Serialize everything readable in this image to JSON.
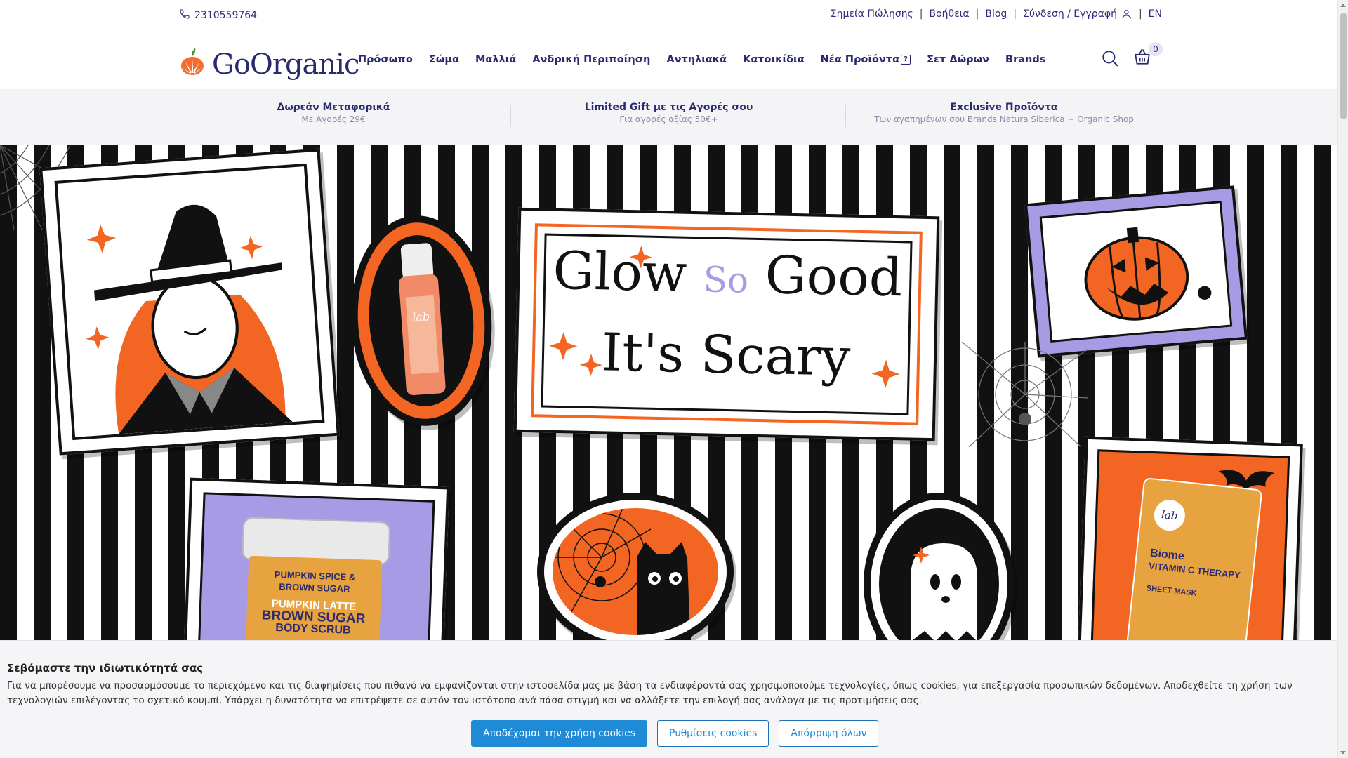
{
  "topbar": {
    "phone": "2310559764",
    "links": [
      "Σημεία Πώλησης",
      "Βοήθεια",
      "Blog",
      "Σύνδεση / Εγγραφή"
    ],
    "lang": "EN"
  },
  "header": {
    "logo": "GoOrganic",
    "nav": [
      "Πρόσωπο",
      "Σώμα",
      "Μαλλιά",
      "Ανδρική Περιποίηση",
      "Αντηλιακά",
      "Κατοικίδια",
      "Νέα Προϊόντα",
      "Σετ Δώρων",
      "Brands"
    ],
    "new_badge": "?",
    "cart_count": "0"
  },
  "usp": [
    {
      "title": "Δωρεάν Μεταφορικά",
      "sub": "Με Αγορές 29€"
    },
    {
      "title": "Limited Gift με τις Αγορές σου",
      "sub": "Για αγορές αξίας 50€+"
    },
    {
      "title": "Exclusive Προϊόντα",
      "sub": "Των αγαπημένων σου Brands Natura Siberica + Organic Shop"
    }
  ],
  "hero": {
    "headline_1": "Glow",
    "headline_so": "So",
    "headline_2": "Good",
    "headline_3": "It's Scary",
    "jar_line_1": "PUMPKIN SPICE &",
    "jar_line_2": "BROWN SUGAR",
    "jar_line_3": "PUMPKIN LATTE",
    "jar_line_4": "BROWN SUGAR",
    "jar_line_5": "BODY SCRUB",
    "mask_brand": "lab",
    "mask_title_1": "Biome",
    "mask_title_2": "VITAMIN C THERAPY",
    "mask_sub": "SHEET MASK",
    "serum_brand": "lab"
  },
  "cookie": {
    "title": "Σεβόμαστε την ιδιωτικότητά σας",
    "text": "Για να μπορέσουμε να προσαρμόσουμε το περιεχόμενο και τις διαφημίσεις που πιθανό να εμφανίζονται στην ιστοσελίδα μας με βάση τα ενδιαφέροντά σας χρησιμοποιούμε τεχνολογίες, όπως cookies, για επεξεργασία προσωπικών δεδομένων. Αποδεχθείτε τη χρήση των τεχνολογιών επιλέγοντας το σχετικό κουμπί. Υπάρχει η δυνατότητα να επιτρέψετε σε αυτόν τον ιστότοπο ανά πάσα στιγμή και να αλλάξετε την επιλογή σας ανάλογα με τις προτιμήσεις σας.",
    "accept": "Αποδέχομαι την χρήση cookies",
    "settings": "Ρυθμίσεις cookies",
    "reject": "Απόρριψη όλων"
  },
  "colors": {
    "brand_navy": "#2a2a6e",
    "orange": "#f26522",
    "purple": "#a89be6",
    "accent_blue": "#1f8ad6"
  }
}
